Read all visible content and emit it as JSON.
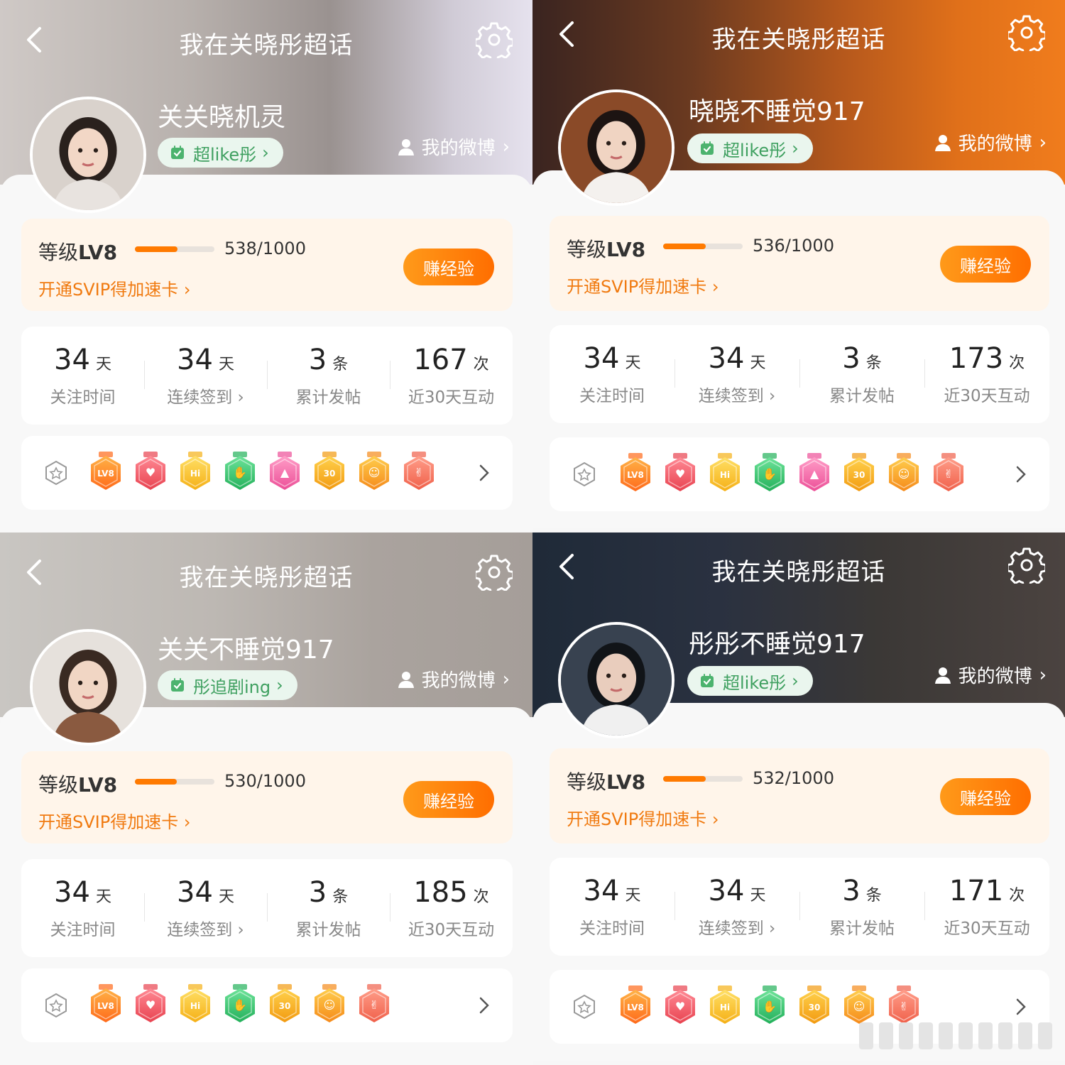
{
  "panels": [
    {
      "title": "我在关晓彤超话",
      "username": "关关晓机灵",
      "tag": "超like彤",
      "my_weibo": "我的微博",
      "level_prefix": "等级",
      "level": "LV8",
      "progress_text": "538/1000",
      "progress_fraction": 0.538,
      "svip": "开通SVIP得加速卡",
      "earn": "赚经验",
      "stats": [
        {
          "num": "34",
          "unit": "天",
          "label": "关注时间"
        },
        {
          "num": "34",
          "unit": "天",
          "label": "连续签到"
        },
        {
          "num": "3",
          "unit": "条",
          "label": "累计发帖"
        },
        {
          "num": "167",
          "unit": "次",
          "label": "近30天互动"
        }
      ],
      "badges": [
        "lv8-badge",
        "heart-badge",
        "hi-badge",
        "hand-badge",
        "book-badge",
        "30-days-badge",
        "confetti-badge",
        "rock-hand-badge"
      ]
    },
    {
      "title": "我在关晓彤超话",
      "username": "晓晓不睡觉917",
      "tag": "超like彤",
      "my_weibo": "我的微博",
      "level_prefix": "等级",
      "level": "LV8",
      "progress_text": "536/1000",
      "progress_fraction": 0.536,
      "svip": "开通SVIP得加速卡",
      "earn": "赚经验",
      "stats": [
        {
          "num": "34",
          "unit": "天",
          "label": "关注时间"
        },
        {
          "num": "34",
          "unit": "天",
          "label": "连续签到"
        },
        {
          "num": "3",
          "unit": "条",
          "label": "累计发帖"
        },
        {
          "num": "173",
          "unit": "次",
          "label": "近30天互动"
        }
      ],
      "badges": [
        "lv8-badge",
        "heart-badge",
        "hi-badge",
        "hand-badge",
        "book-badge",
        "30-days-badge",
        "confetti-badge",
        "rock-hand-badge"
      ]
    },
    {
      "title": "我在关晓彤超话",
      "username": "关关不睡觉917",
      "tag": "彤追剧ing",
      "my_weibo": "我的微博",
      "level_prefix": "等级",
      "level": "LV8",
      "progress_text": "530/1000",
      "progress_fraction": 0.53,
      "svip": "开通SVIP得加速卡",
      "earn": "赚经验",
      "stats": [
        {
          "num": "34",
          "unit": "天",
          "label": "关注时间"
        },
        {
          "num": "34",
          "unit": "天",
          "label": "连续签到"
        },
        {
          "num": "3",
          "unit": "条",
          "label": "累计发帖"
        },
        {
          "num": "185",
          "unit": "次",
          "label": "近30天互动"
        }
      ],
      "badges": [
        "lv8-badge",
        "heart-badge",
        "hi-badge",
        "hand-badge",
        "30-days-badge",
        "confetti-badge",
        "rock-hand-badge"
      ]
    },
    {
      "title": "我在关晓彤超话",
      "username": "彤彤不睡觉917",
      "tag": "超like彤",
      "my_weibo": "我的微博",
      "level_prefix": "等级",
      "level": "LV8",
      "progress_text": "532/1000",
      "progress_fraction": 0.532,
      "svip": "开通SVIP得加速卡",
      "earn": "赚经验",
      "stats": [
        {
          "num": "34",
          "unit": "天",
          "label": "关注时间"
        },
        {
          "num": "34",
          "unit": "天",
          "label": "连续签到"
        },
        {
          "num": "3",
          "unit": "条",
          "label": "累计发帖"
        },
        {
          "num": "171",
          "unit": "次",
          "label": "近30天互动"
        }
      ],
      "badges": [
        "lv8-badge",
        "heart-badge",
        "hi-badge",
        "hand-badge",
        "30-days-badge",
        "confetti-badge",
        "rock-hand-badge"
      ]
    }
  ],
  "colors": {
    "accent_orange": "#ff7a00",
    "tag_green": "#3fa060",
    "level_box_bg": "#fff5ea"
  }
}
